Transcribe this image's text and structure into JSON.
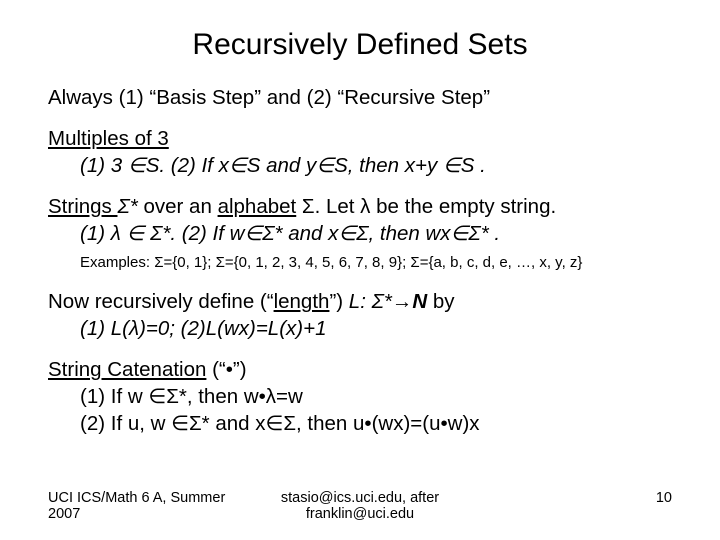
{
  "title": "Recursively Defined Sets",
  "p1": "Always (1) “Basis Step” and (2) “Recursive Step”",
  "p2_head": "Multiples of 3",
  "p2_line": "(1) 3 ∈S.  (2) If x∈S and y∈S, then x+y ∈S .",
  "p3_a": "Strings ",
  "p3_b": "Σ*",
  "p3_c": " over an ",
  "p3_d": "alphabet",
  "p3_e": " Σ.  Let λ be the empty string.",
  "p3_line": "(1) λ ∈ Σ*.  (2) If w∈Σ* and x∈Σ, then wx∈Σ* .",
  "p3_ex": "Examples: Σ={0, 1}; Σ={0, 1, 2, 3, 4, 5, 6, 7, 8, 9}; Σ={a, b, c, d, e, …, x, y, z}",
  "p4_a": "Now recursively define (“",
  "p4_b": "length",
  "p4_c": "”) ",
  "p4_d": "L: Σ*→",
  "p4_e": "N",
  "p4_f": " by",
  "p4_line": "(1) L(λ)=0; (2)L(wx)=L(x)+1",
  "p5_a": "String Catenation",
  "p5_b": " (“•”)",
  "p5_l1": "(1) If w ∈Σ*, then w•λ=w",
  "p5_l2": "(2) If u, w ∈Σ* and x∈Σ, then u•(wx)=(u•w)x",
  "footer_left": "UCI ICS/Math 6 A, Summer 2007",
  "footer_center1": "stasio@ics.uci.edu, after",
  "footer_center2": "franklin@uci.edu",
  "footer_right": "10"
}
